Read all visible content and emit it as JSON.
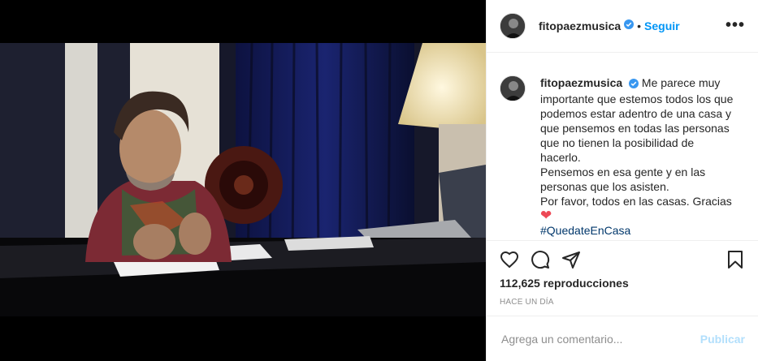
{
  "post": {
    "username": "fitopaezmusica",
    "follow_label": "Seguir",
    "more_label": "•••",
    "dot": "•",
    "caption_lines": [
      "Me parece muy importante que estemos todos los que podemos estar adentro de una casa y que pensemos en todas las personas que no tienen la posibilidad de hacerlo.",
      "Pensemos en esa gente y en las personas que los asisten.",
      "Por favor, todos en las casas. Gracias"
    ],
    "heart_emoji": "❤",
    "hashtag": "#QuedateEnCasa",
    "views": "112,625 reproducciones",
    "time": "HACE UN DÍA",
    "comment_placeholder": "Agrega un comentario...",
    "publish_label": "Publicar"
  },
  "colors": {
    "accent": "#0095f6",
    "verified": "#3897f0",
    "publish_disabled": "#b2dffc",
    "heart": "#ed4956"
  }
}
